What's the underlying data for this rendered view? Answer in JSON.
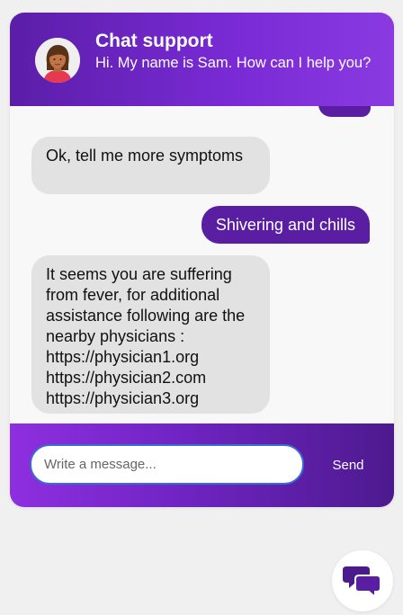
{
  "header": {
    "title": "Chat support",
    "subtitle": "Hi. My name is Sam. How can I help you?"
  },
  "messages": [
    {
      "sender": "bot",
      "text": "Ok, tell me more symptoms"
    },
    {
      "sender": "user",
      "text": "Shivering and chills"
    },
    {
      "sender": "bot",
      "text": "It seems you are suffering from fever, for additional assistance following are the nearby physicians :\nhttps://physician1.org\nhttps://physician2.com\nhttps://physician3.org"
    }
  ],
  "composer": {
    "placeholder": "Write a message...",
    "send_label": "Send"
  },
  "icons": {
    "avatar": "agent-avatar",
    "launcher": "chat-bubbles-icon"
  },
  "colors": {
    "accent": "#5a1ea2",
    "header_gradient_start": "#5b1ea8",
    "header_gradient_end": "#8a3ae0",
    "bot_bubble": "#e2e2e2",
    "input_border": "#3b6bd6"
  }
}
